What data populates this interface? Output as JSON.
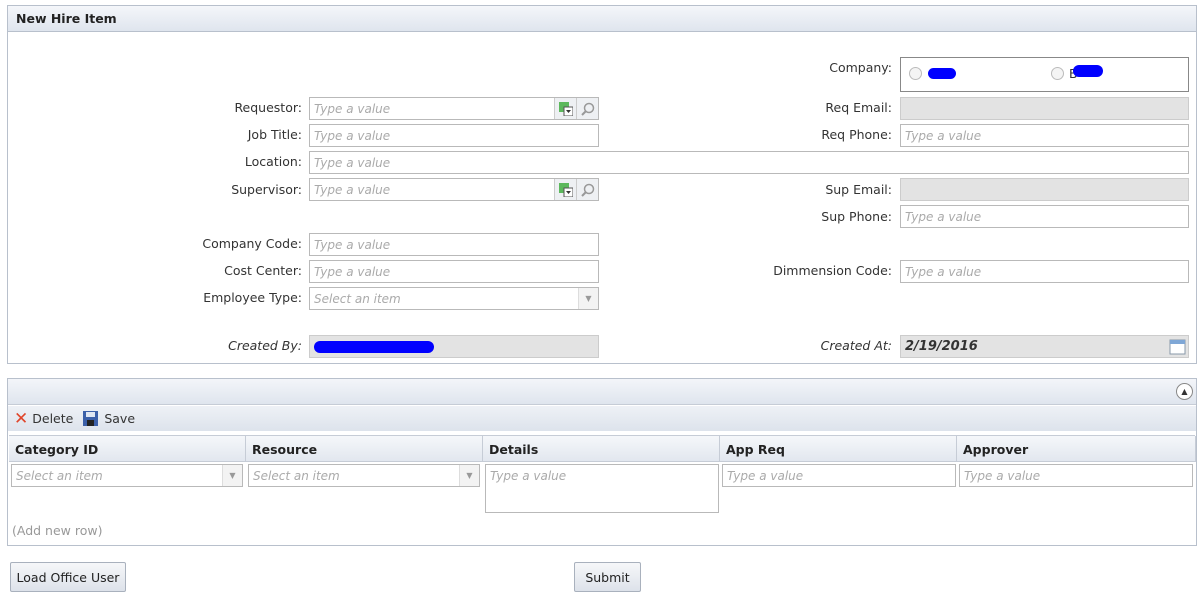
{
  "panel": {
    "title": "New Hire Item"
  },
  "form": {
    "company_label": "Company:",
    "company_option2_visible": "B",
    "requestor_label": "Requestor:",
    "job_title_label": "Job Title:",
    "location_label": "Location:",
    "supervisor_label": "Supervisor:",
    "company_code_label": "Company Code:",
    "cost_center_label": "Cost Center:",
    "employee_type_label": "Employee Type:",
    "created_by_label": "Created By:",
    "created_at_label": "Created At:",
    "created_at_value": "2/19/2016",
    "req_email_label": "Req Email:",
    "req_phone_label": "Req Phone:",
    "sup_email_label": "Sup Email:",
    "sup_phone_label": "Sup Phone:",
    "dimension_code_label": "Dimmension Code:",
    "placeholder": "Type a value",
    "select_placeholder": "Select an item"
  },
  "grid": {
    "toolbar": {
      "delete_label": "Delete",
      "save_label": "Save"
    },
    "columns": [
      "Category ID",
      "Resource",
      "Details",
      "App Req",
      "Approver"
    ],
    "add_row": "(Add new row)"
  },
  "buttons": {
    "load_office_user": "Load Office User",
    "submit": "Submit"
  }
}
